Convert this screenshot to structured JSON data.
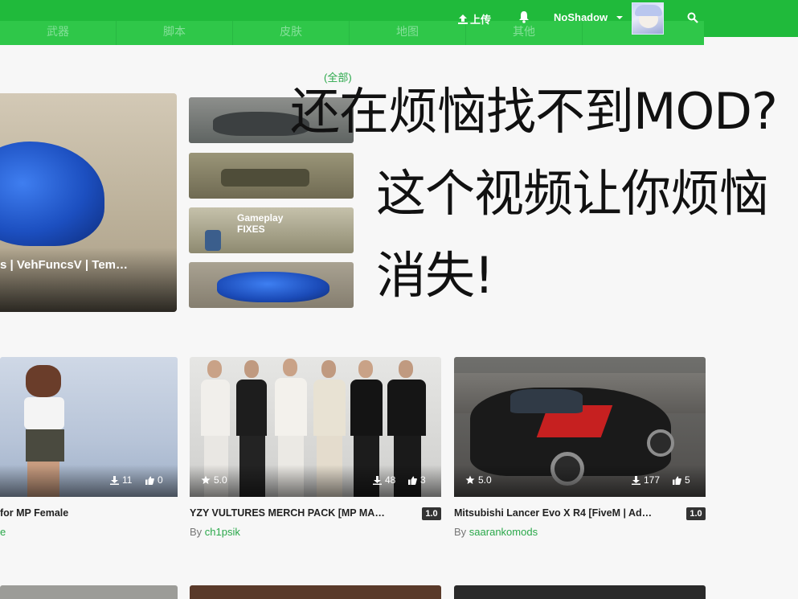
{
  "nav": {
    "categories": [
      "武器",
      "脚本",
      "皮肤",
      "地图",
      "其他"
    ],
    "upload_label": "上传",
    "username": "NoShadow"
  },
  "section": {
    "all_link": "(全部)"
  },
  "overlay": {
    "line1": "还在烦恼找不到MOD?",
    "line2": "这个视频让你烦恼",
    "line3": "消失!"
  },
  "featured": {
    "title": "s | VehFuncsV | Tem…",
    "thumb_text": "Gameplay FIXES"
  },
  "cards": [
    {
      "title": "for MP Female",
      "version": "",
      "author_prefix": "",
      "author": "e",
      "rating": "",
      "downloads": "11",
      "likes": "0"
    },
    {
      "title": "YZY VULTURES MERCH PACK [MP MA…",
      "version": "1.0",
      "author_prefix": "By ",
      "author": "ch1psik",
      "rating": "5.0",
      "downloads": "48",
      "likes": "3"
    },
    {
      "title": "Mitsubishi Lancer Evo X R4 [FiveM | Ad…",
      "version": "1.0",
      "author_prefix": "By ",
      "author": "saarankomods",
      "rating": "5.0",
      "downloads": "177",
      "likes": "5"
    }
  ],
  "colors": {
    "brand_green": "#20ba3b",
    "author_link": "#2aa84a"
  },
  "icons": [
    "upload-icon",
    "bell-icon",
    "caret-down-icon",
    "search-icon",
    "star-icon",
    "download-icon",
    "thumbs-up-icon"
  ]
}
